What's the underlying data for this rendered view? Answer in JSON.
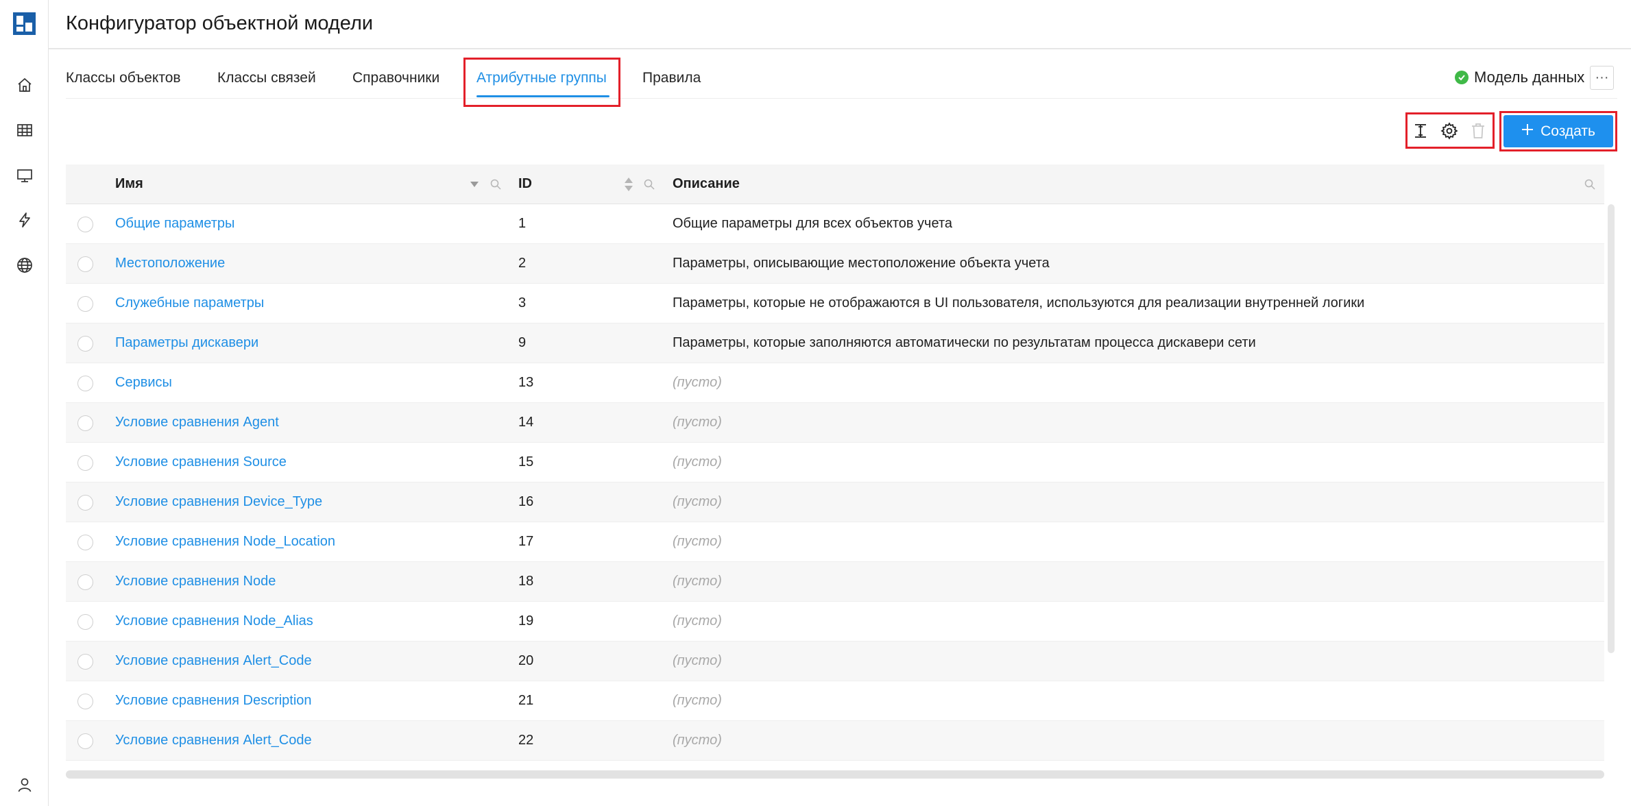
{
  "header": {
    "title": "Конфигуратор объектной модели"
  },
  "tabs": [
    {
      "label": "Классы объектов"
    },
    {
      "label": "Классы связей"
    },
    {
      "label": "Справочники"
    },
    {
      "label": "Атрибутные группы"
    },
    {
      "label": "Правила"
    }
  ],
  "active_tab": "Атрибутные группы",
  "status": {
    "label": "Модель данных",
    "more_label": "···"
  },
  "toolbar": {
    "create_label": "Создать"
  },
  "icons": {
    "sidebar": [
      "home-icon",
      "table-icon",
      "monitor-icon",
      "lightning-icon",
      "globe-icon",
      "user-icon"
    ],
    "toolbar": [
      "row-height-icon",
      "gear-icon",
      "trash-icon"
    ]
  },
  "colors": {
    "accent": "#1e90ee",
    "highlight": "#e3202a",
    "status_ok": "#3fb947"
  },
  "table": {
    "columns": {
      "name": "Имя",
      "id": "ID",
      "description": "Описание"
    },
    "rows": [
      {
        "name": "Общие параметры",
        "id": "1",
        "description": "Общие параметры для всех объектов учета"
      },
      {
        "name": "Местоположение",
        "id": "2",
        "description": "Параметры, описывающие местоположение объекта учета"
      },
      {
        "name": "Служебные параметры",
        "id": "3",
        "description": "Параметры, которые не отображаются в UI пользователя, используются для реализации внутренней логики"
      },
      {
        "name": "Параметры дискавери",
        "id": "9",
        "description": "Параметры, которые заполняются автоматически по результатам процесса дискавери сети"
      },
      {
        "name": "Сервисы",
        "id": "13",
        "description": "(пусто)"
      },
      {
        "name": "Условие сравнения Agent",
        "id": "14",
        "description": "(пусто)"
      },
      {
        "name": "Условие сравнения Source",
        "id": "15",
        "description": "(пусто)"
      },
      {
        "name": "Условие сравнения Device_Type",
        "id": "16",
        "description": "(пусто)"
      },
      {
        "name": "Условие сравнения Node_Location",
        "id": "17",
        "description": "(пусто)"
      },
      {
        "name": "Условие сравнения Node",
        "id": "18",
        "description": "(пусто)"
      },
      {
        "name": "Условие сравнения Node_Alias",
        "id": "19",
        "description": "(пусто)"
      },
      {
        "name": "Условие сравнения Alert_Code",
        "id": "20",
        "description": "(пусто)"
      },
      {
        "name": "Условие сравнения Description",
        "id": "21",
        "description": "(пусто)"
      },
      {
        "name": "Условие сравнения Alert_Code",
        "id": "22",
        "description": "(пусто)"
      }
    ]
  }
}
